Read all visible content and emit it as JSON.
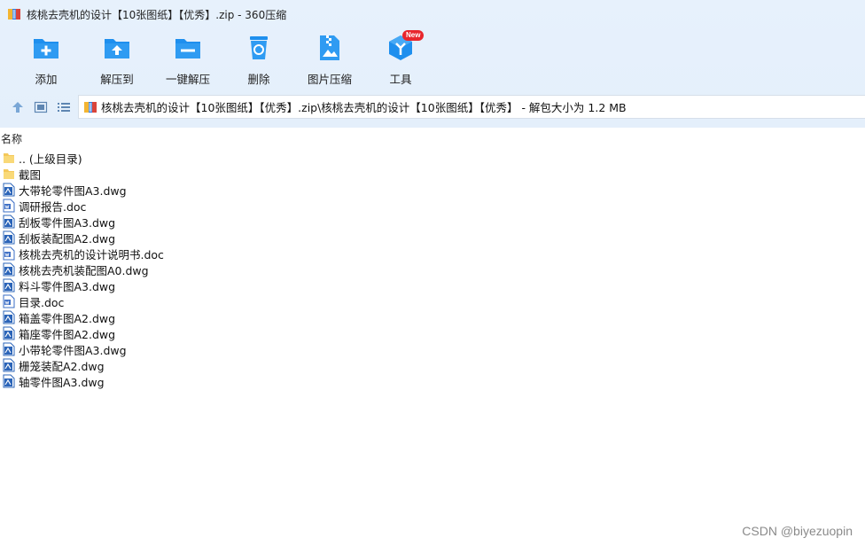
{
  "window": {
    "title": "核桃去壳机的设计【10张图纸】【优秀】.zip - 360压缩",
    "app_icon": "archive-app-icon"
  },
  "toolbar": {
    "items": [
      {
        "label": "添加",
        "icon": "add-folder-icon"
      },
      {
        "label": "解压到",
        "icon": "extract-to-icon"
      },
      {
        "label": "一键解压",
        "icon": "one-click-extract-icon"
      },
      {
        "label": "删除",
        "icon": "recycle-bin-icon"
      },
      {
        "label": "图片压缩",
        "icon": "image-compress-icon"
      },
      {
        "label": "工具",
        "icon": "tools-cube-icon",
        "badge": "New"
      }
    ]
  },
  "address": {
    "path": "核桃去壳机的设计【10张图纸】【优秀】.zip\\核桃去壳机的设计【10张图纸】【优秀】 - 解包大小为 1.2 MB",
    "nav_icons": [
      "up-arrow-icon",
      "thumbnail-view-icon",
      "list-view-icon"
    ]
  },
  "list": {
    "column_name": "名称",
    "files": [
      {
        "name": ".. (上级目录)",
        "type": "folder"
      },
      {
        "name": "截图",
        "type": "folder"
      },
      {
        "name": "大带轮零件图A3.dwg",
        "type": "dwg"
      },
      {
        "name": "调研报告.doc",
        "type": "doc"
      },
      {
        "name": "刮板零件图A3.dwg",
        "type": "dwg"
      },
      {
        "name": "刮板装配图A2.dwg",
        "type": "dwg"
      },
      {
        "name": "核桃去壳机的设计说明书.doc",
        "type": "doc"
      },
      {
        "name": "核桃去壳机装配图A0.dwg",
        "type": "dwg"
      },
      {
        "name": "料斗零件图A3.dwg",
        "type": "dwg"
      },
      {
        "name": "目录.doc",
        "type": "doc"
      },
      {
        "name": "箱盖零件图A2.dwg",
        "type": "dwg"
      },
      {
        "name": "箱座零件图A2.dwg",
        "type": "dwg"
      },
      {
        "name": "小带轮零件图A3.dwg",
        "type": "dwg"
      },
      {
        "name": "栅笼装配A2.dwg",
        "type": "dwg"
      },
      {
        "name": "轴零件图A3.dwg",
        "type": "dwg"
      }
    ]
  },
  "watermark": "CSDN @biyezuopin",
  "colors": {
    "accent": "#1e90ef",
    "toolbar_bg": "#e5effb",
    "badge": "#e8262d"
  }
}
